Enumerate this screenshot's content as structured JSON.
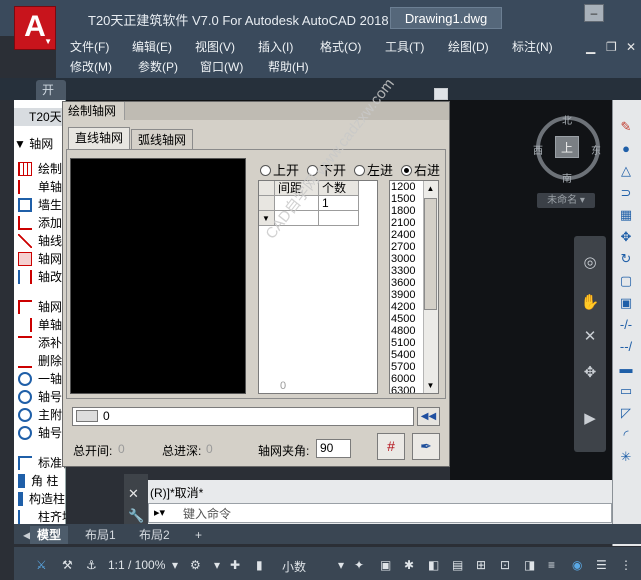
{
  "titlebar": {
    "logo_letter": "A",
    "title": "T20天正建筑软件 V7.0 For Autodesk AutoCAD 2018",
    "doc_tab": "Drawing1.dwg"
  },
  "menubar": {
    "row1": [
      "文件(F)",
      "编辑(E)",
      "视图(V)",
      "插入(I)",
      "格式(O)",
      "工具(T)",
      "绘图(D)",
      "标注(N)"
    ],
    "row2": [
      "修改(M)",
      "参数(P)",
      "窗口(W)",
      "帮助(H)"
    ]
  },
  "drawing_tabs": {
    "start": "开"
  },
  "palette": {
    "header": "T20天",
    "axis_header": "▼ 轴网",
    "items": [
      "绘制",
      "单轴",
      "墙生",
      "添加",
      "轴线",
      "轴网",
      "轴改",
      "轴网",
      "单轴",
      "添补",
      "删除",
      "一轴",
      "轴号",
      "主附",
      "轴号",
      "标准柱",
      "角  柱",
      "构造柱",
      "柱齐墙边"
    ]
  },
  "dialog": {
    "title": "绘制轴网",
    "tabs": [
      "直线轴网",
      "弧线轴网"
    ],
    "radios": [
      {
        "label": "上开",
        "checked": false
      },
      {
        "label": "下开",
        "checked": false
      },
      {
        "label": "左进",
        "checked": false
      },
      {
        "label": "右进",
        "checked": true
      }
    ],
    "grid": {
      "headers": [
        "间距",
        "个数"
      ],
      "rows": [
        [
          "",
          "1"
        ],
        [
          "",
          ""
        ]
      ],
      "footer_value": "0"
    },
    "values": [
      "1200",
      "1500",
      "1800",
      "2100",
      "2400",
      "2700",
      "3000",
      "3300",
      "3600",
      "3900",
      "4200",
      "4500",
      "4800",
      "5100",
      "5400",
      "5700",
      "6000",
      "6300"
    ],
    "input_value": "0",
    "total_open_label": "总开间:",
    "total_open_value": "0",
    "total_depth_label": "总进深:",
    "total_depth_value": "0",
    "angle_label": "轴网夹角:",
    "angle_value": "90"
  },
  "viewcube": {
    "face": "上",
    "north": "北",
    "south": "南",
    "west": "西",
    "east": "东",
    "wcs": "未命名 ▾"
  },
  "command": {
    "history": "(R)]*取消*",
    "placeholder": "键入命令"
  },
  "layout_tabs": [
    "模型",
    "布局1",
    "布局2",
    "+"
  ],
  "status": {
    "scale": "1:1 / 100%",
    "units": "小数"
  },
  "watermark": "CAD自学网 www.cadzxw.com"
}
